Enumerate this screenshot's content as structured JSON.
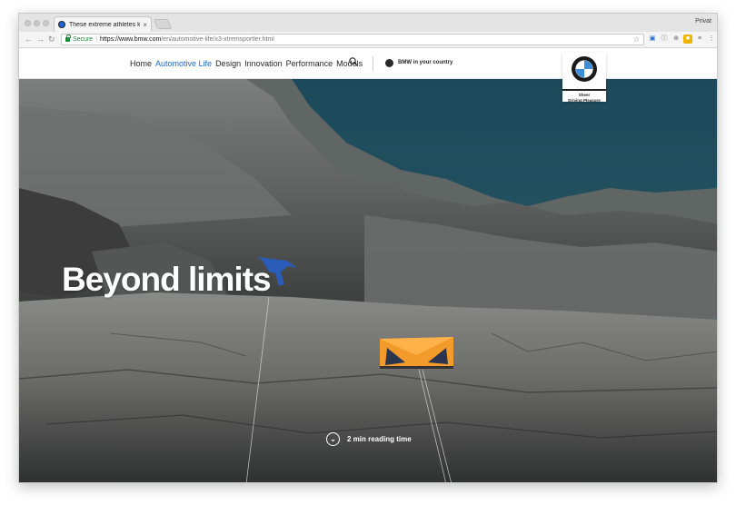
{
  "browser": {
    "tab_title": "These extreme athletes know",
    "tab_close": "×",
    "profile_label": "Privat",
    "secure_label": "Secure",
    "url_scheme_host": "https://www.bmw.com",
    "url_path": "/en/automotive-life/x3-xtremsportler.html"
  },
  "site": {
    "nav_items": [
      "Home",
      "Automotive Life",
      "Design",
      "Innovation",
      "Performance",
      "Models"
    ],
    "active_nav": "Automotive Life",
    "country_label": "BMW in your country",
    "logo_tagline_1": "Sheer",
    "logo_tagline_2": "Driving Pleasure"
  },
  "hero": {
    "headline": "Beyond limits",
    "reading_time": "2 min reading time"
  },
  "colors": {
    "accent": "#1c69d4",
    "secure_green": "#1a8a3a",
    "text_dark": "#262626"
  }
}
